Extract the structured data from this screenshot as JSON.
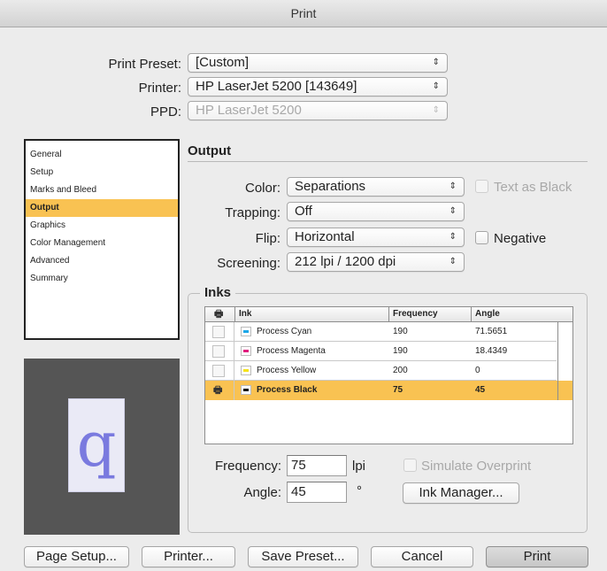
{
  "window": {
    "title": "Print"
  },
  "top": {
    "preset_label": "Print Preset:",
    "preset_value": "[Custom]",
    "printer_label": "Printer:",
    "printer_value": "HP LaserJet 5200 [143649]",
    "ppd_label": "PPD:",
    "ppd_value": "HP LaserJet 5200"
  },
  "sidebar": {
    "items": [
      {
        "label": "General"
      },
      {
        "label": "Setup"
      },
      {
        "label": "Marks and Bleed"
      },
      {
        "label": "Output"
      },
      {
        "label": "Graphics"
      },
      {
        "label": "Color Management"
      },
      {
        "label": "Advanced"
      },
      {
        "label": "Summary"
      }
    ],
    "selected": "Output"
  },
  "preview": {
    "glyph": "q"
  },
  "output": {
    "title": "Output",
    "color_label": "Color:",
    "color_value": "Separations",
    "text_as_black": "Text as Black",
    "trapping_label": "Trapping:",
    "trapping_value": "Off",
    "flip_label": "Flip:",
    "flip_value": "Horizontal",
    "negative": "Negative",
    "screening_label": "Screening:",
    "screening_value": "212 lpi / 1200 dpi"
  },
  "inks": {
    "title": "Inks",
    "columns": {
      "ink": "Ink",
      "frequency": "Frequency",
      "angle": "Angle"
    },
    "rows": [
      {
        "name": "Process Cyan",
        "frequency": "190",
        "angle": "71.5651",
        "color": "#1aa7e8",
        "print": false
      },
      {
        "name": "Process Magenta",
        "frequency": "190",
        "angle": "18.4349",
        "color": "#e0197d",
        "print": false
      },
      {
        "name": "Process Yellow",
        "frequency": "200",
        "angle": "0",
        "color": "#f5e21a",
        "print": false
      },
      {
        "name": "Process Black",
        "frequency": "75",
        "angle": "45",
        "color": "#111111",
        "print": true
      }
    ],
    "frequency_label": "Frequency:",
    "frequency_value": "75",
    "frequency_unit": "lpi",
    "angle_label": "Angle:",
    "angle_value": "45",
    "angle_unit": "°",
    "simulate_overprint": "Simulate Overprint",
    "ink_manager": "Ink Manager..."
  },
  "buttons": {
    "page_setup": "Page Setup...",
    "printer": "Printer...",
    "save_preset": "Save Preset...",
    "cancel": "Cancel",
    "print": "Print"
  },
  "colors": {
    "selection": "#f9c252",
    "preview_bg": "#555555",
    "glyph": "#7a7adf"
  }
}
